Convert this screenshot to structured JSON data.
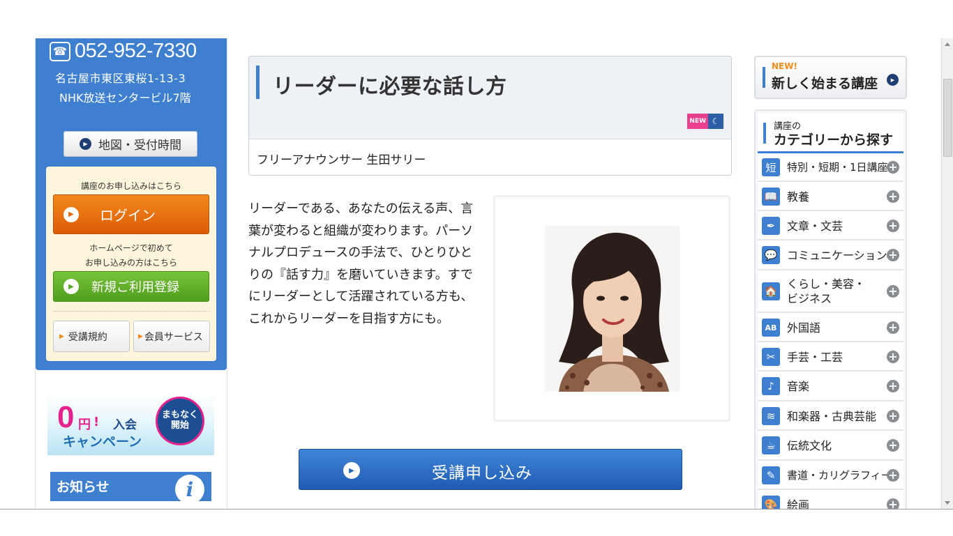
{
  "contact": {
    "phone": "052-952-7330",
    "address_line1": "名古屋市東区東桜1-13-3",
    "address_line2": "NHK放送センタービル7階",
    "map_button": "地図・受付時間"
  },
  "apply_box": {
    "caption": "講座のお申し込みはこちら",
    "login_label": "ログイン",
    "first_time_line1": "ホームページで初めて",
    "first_time_line2": "お申し込みの方はこちら",
    "register_label": "新規ご利用登録",
    "terms_label": "受講規約",
    "member_label": "会員サービス"
  },
  "campaign": {
    "zero": "0",
    "yen": "円",
    "join": "入会",
    "campaign": "キャンペーン",
    "soon_line1": "まもなく",
    "soon_line2": "開始"
  },
  "news": {
    "title": "お知らせ",
    "icon": "info-icon"
  },
  "course": {
    "title": "リーダーに必要な話し方",
    "badge_new": "NEW",
    "instructor": "フリーアナウンサー 生田サリー",
    "description": "リーダーである、あなたの伝える声、言葉が変わると組織が変わります。パーソナルプロデュースの手法で、ひとりひとりの『話す力』を磨いていきます。すでにリーダーとして活躍されている方も、これからリーダーを目指す方にも。",
    "apply_button": "受講申し込み"
  },
  "sidebar": {
    "new_tag": "NEW!",
    "new_courses": "新しく始まる講座",
    "category_small": "講座の",
    "category_big": "カテゴリーから探す",
    "categories": [
      {
        "icon": "短",
        "label": "特別・短期・1日講座"
      },
      {
        "icon": "📖",
        "label": "教養"
      },
      {
        "icon": "✒",
        "label": "文章・文芸"
      },
      {
        "icon": "💬",
        "label": "コミュニケーション"
      },
      {
        "icon": "🏠",
        "label": "くらし・美容・\nビジネス"
      },
      {
        "icon": "AB",
        "label": "外国語"
      },
      {
        "icon": "✂",
        "label": "手芸・工芸"
      },
      {
        "icon": "♪",
        "label": "音楽"
      },
      {
        "icon": "≋",
        "label": "和楽器・古典芸能"
      },
      {
        "icon": "☕",
        "label": "伝統文化"
      },
      {
        "icon": "✎",
        "label": "書道・カリグラフィー"
      },
      {
        "icon": "🎨",
        "label": "絵画"
      }
    ]
  },
  "colors": {
    "primary_blue": "#3f7fd0",
    "login_orange": "#e8741a",
    "register_green": "#5eab28",
    "apply_blue": "#2a6ec6"
  }
}
